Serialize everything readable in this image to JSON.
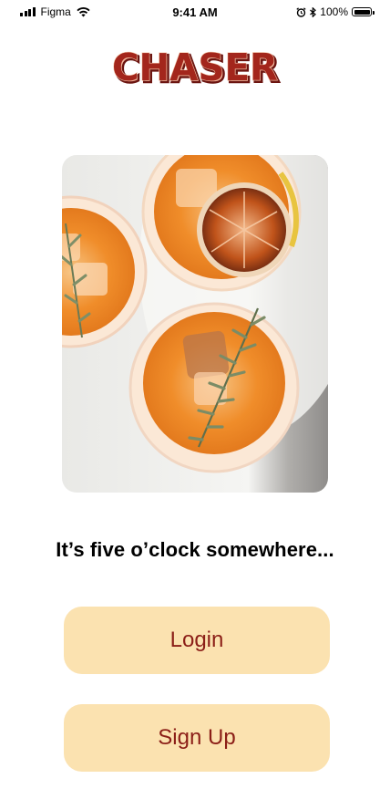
{
  "status_bar": {
    "carrier": "Figma",
    "time": "9:41 AM",
    "battery": "100%"
  },
  "logo": {
    "text": "CHASER"
  },
  "hero": {
    "alt": "Two orange cocktails with dried citrus and rosemary, top view"
  },
  "tagline": "It’s five o’clock somewhere...",
  "buttons": {
    "login": "Login",
    "signup": "Sign Up"
  },
  "colors": {
    "brand": "#a3261c",
    "button_bg": "#fbe2b0",
    "button_text": "#8b1e17"
  }
}
